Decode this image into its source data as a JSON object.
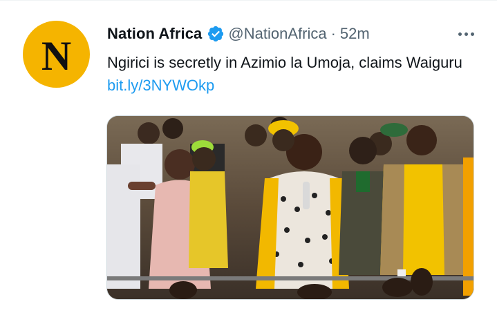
{
  "author": {
    "avatar_letter": "N",
    "display_name": "Nation Africa",
    "handle": "@NationAfrica",
    "separator": "·",
    "timestamp": "52m"
  },
  "tweet": {
    "text": "Ngirici is secretly in Azimio la Umoja, claims Waiguru",
    "link": "bit.ly/3NYWOkp"
  },
  "icons": {
    "verified": "verified-badge-icon",
    "more": "more-options-icon"
  },
  "colors": {
    "avatar_bg": "#f5b400",
    "link": "#1d9bf0",
    "verified": "#1d9bf0",
    "secondary_text": "#536471"
  }
}
